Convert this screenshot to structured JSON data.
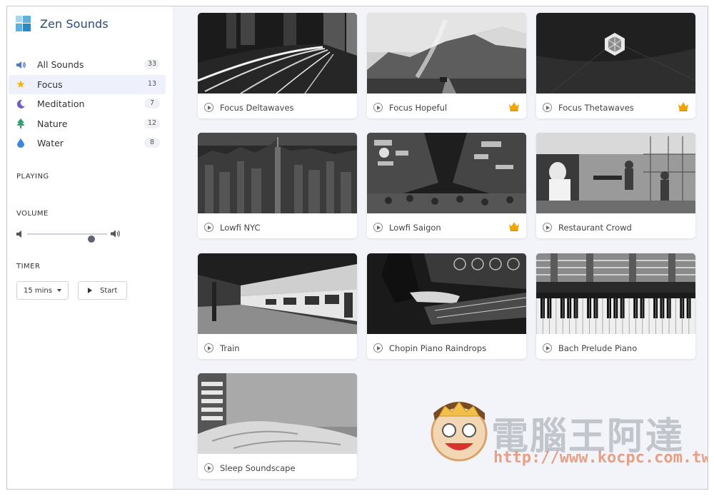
{
  "app": {
    "name": "Zen Sounds"
  },
  "nav": [
    {
      "label": "All Sounds",
      "count": "33",
      "icon": "speaker-icon"
    },
    {
      "label": "Focus",
      "count": "13",
      "icon": "star-icon",
      "active": true
    },
    {
      "label": "Meditation",
      "count": "7",
      "icon": "moon-icon"
    },
    {
      "label": "Nature",
      "count": "12",
      "icon": "tree-icon"
    },
    {
      "label": "Water",
      "count": "8",
      "icon": "drop-icon"
    }
  ],
  "sections": {
    "playing": "PLAYING",
    "volume": "VOLUME",
    "timer": "TIMER"
  },
  "volume": {
    "level": 0.8
  },
  "timer": {
    "selected": "15 mins",
    "start_label": "Start"
  },
  "sounds": [
    {
      "title": "Focus Deltawaves",
      "premium": false
    },
    {
      "title": "Focus Hopeful",
      "premium": true
    },
    {
      "title": "Focus Thetawaves",
      "premium": true
    },
    {
      "title": "Lowfi NYC",
      "premium": false
    },
    {
      "title": "Lowfi Saigon",
      "premium": true
    },
    {
      "title": "Restaurant Crowd",
      "premium": false
    },
    {
      "title": "Train",
      "premium": false
    },
    {
      "title": "Chopin Piano Raindrops",
      "premium": false
    },
    {
      "title": "Bach Prelude Piano",
      "premium": false
    },
    {
      "title": "Sleep Soundscape",
      "premium": false
    }
  ],
  "watermark": {
    "chinese": "電腦王阿達",
    "url": "http://www.kocpc.com.tw"
  },
  "colors": {
    "accent": "#4a78c9",
    "active_bg": "#eef1fb",
    "crown": "#f0a500",
    "main_bg": "#f3f4f9"
  }
}
